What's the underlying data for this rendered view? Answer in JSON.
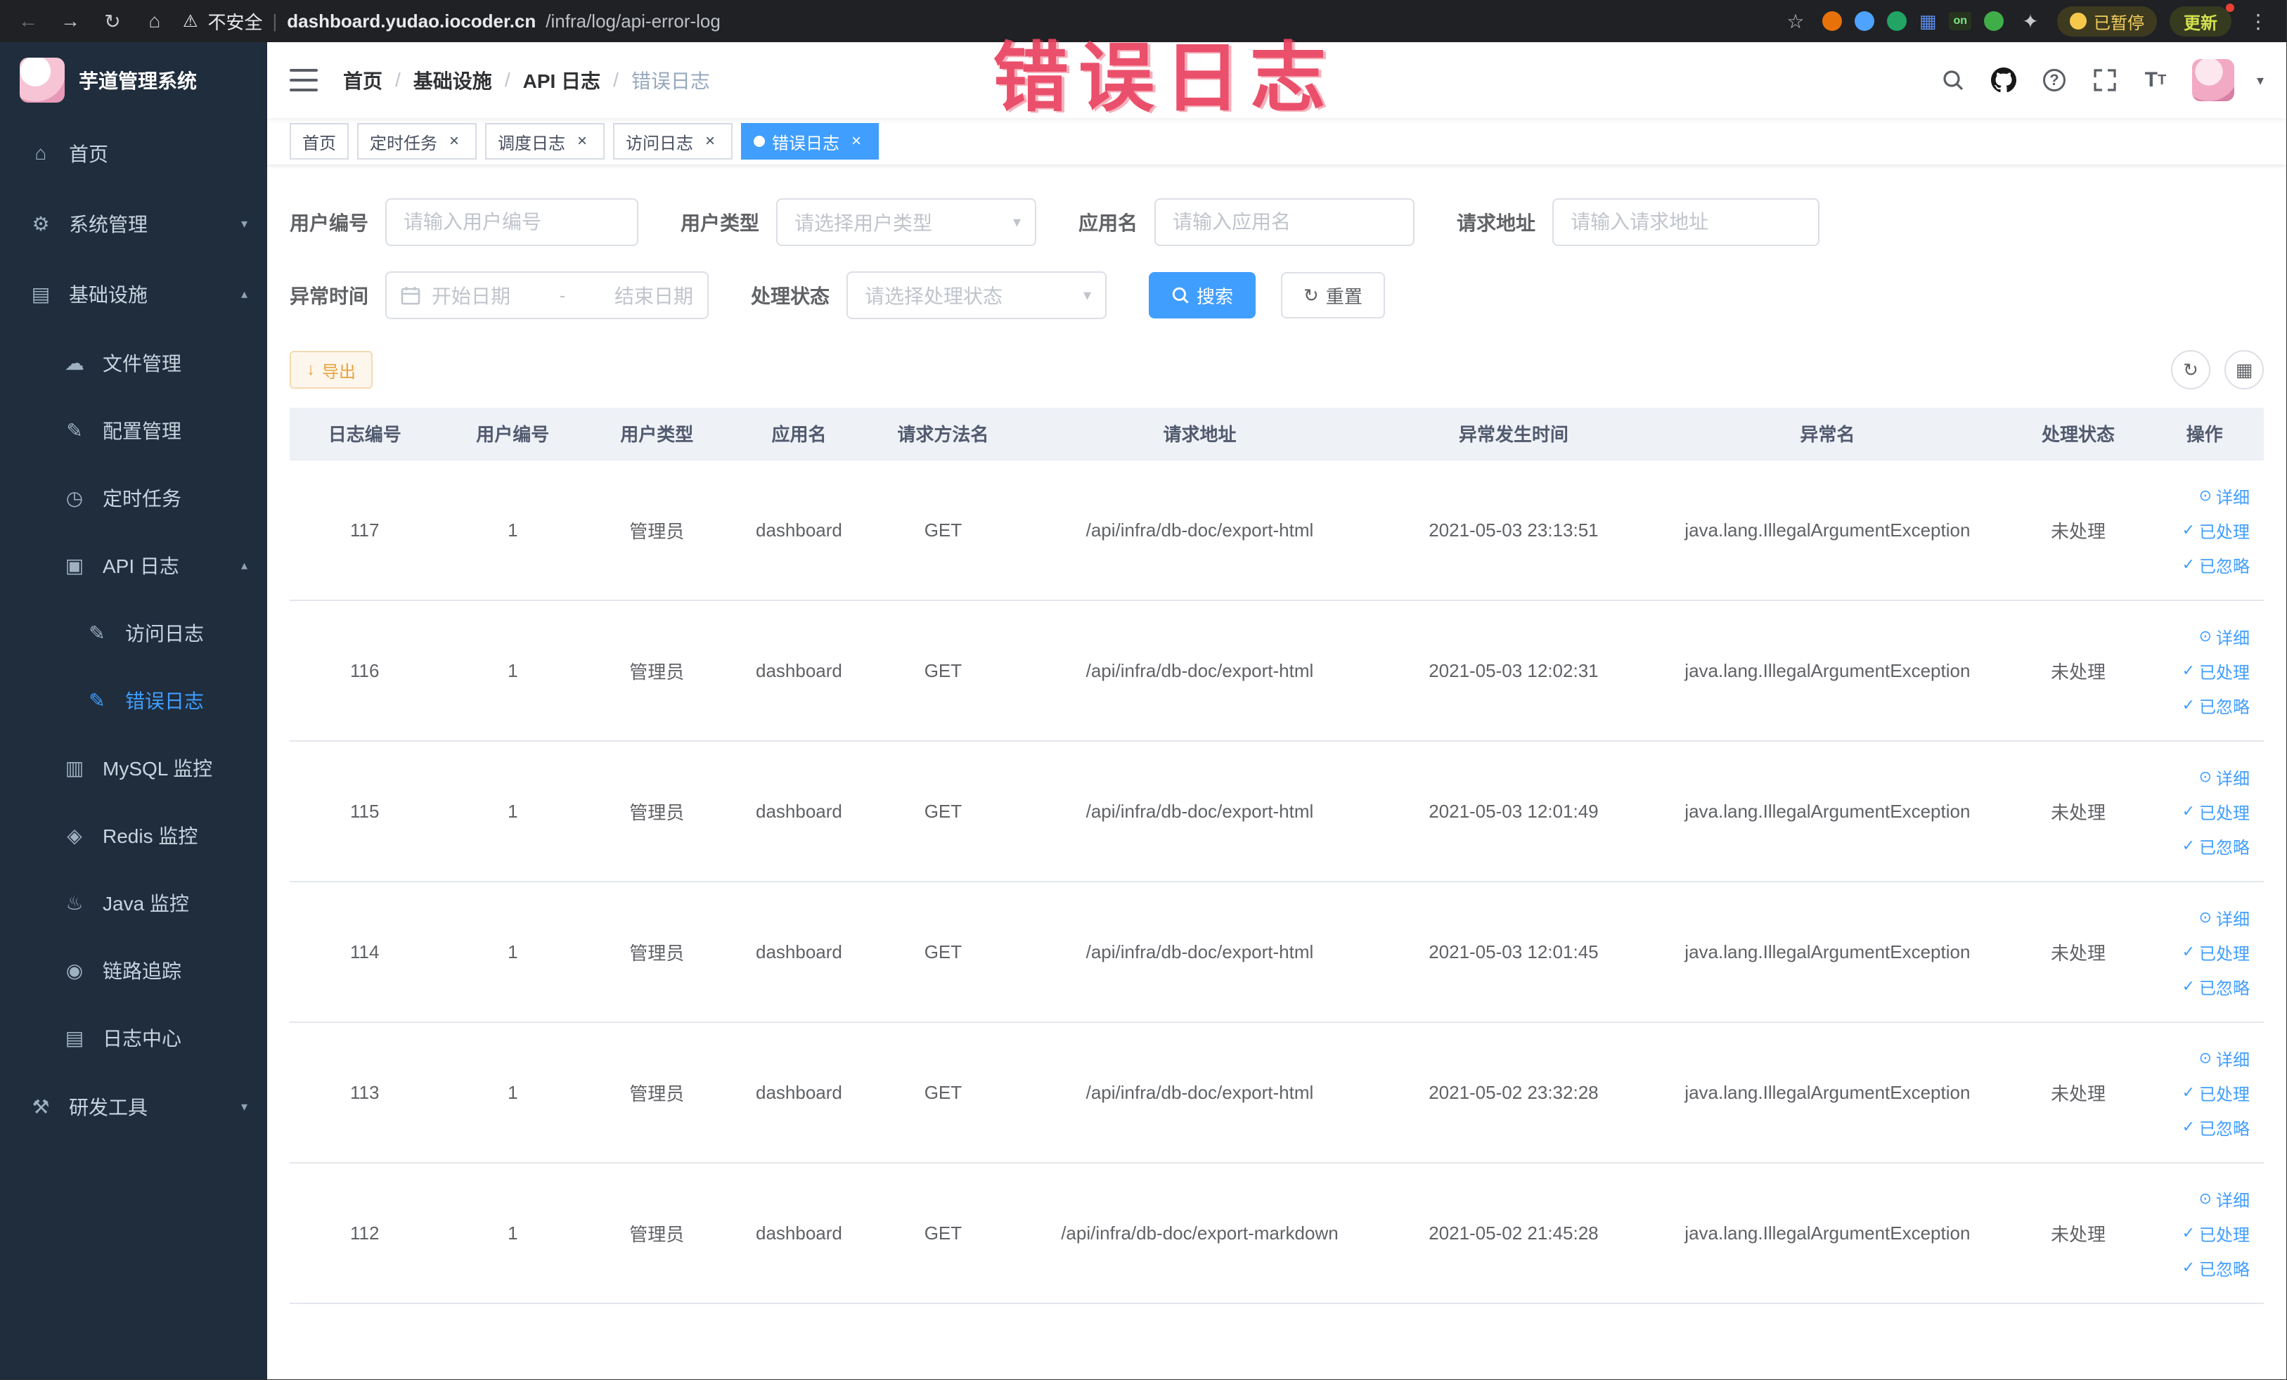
{
  "colors": {
    "primary": "#409eff",
    "warning": "#e6a23c",
    "stamp": "#e94360",
    "sidebar_bg": "#1f2d3d"
  },
  "browser": {
    "security_label": "不安全",
    "url_host": "dashboard.yudao.iocoder.cn",
    "url_path": "/infra/log/api-error-log",
    "on_badge": "on",
    "paused_badge": "已暂停",
    "update_button": "更新"
  },
  "overlay": {
    "stamp_text": "错误日志"
  },
  "sidebar": {
    "logo_title": "芋道管理系统",
    "items": [
      {
        "name": "home",
        "label": "首页",
        "icon": "home-icon",
        "level": 1
      },
      {
        "name": "system-management",
        "label": "系统管理",
        "icon": "gear-icon",
        "level": 1,
        "chevron": "down"
      },
      {
        "name": "infrastructure",
        "label": "基础设施",
        "icon": "grid-icon",
        "level": 1,
        "chevron": "up"
      },
      {
        "name": "file-management",
        "label": "文件管理",
        "icon": "cloud-icon",
        "level": 2
      },
      {
        "name": "config-management",
        "label": "配置管理",
        "icon": "edit-icon",
        "level": 2
      },
      {
        "name": "scheduled-tasks",
        "label": "定时任务",
        "icon": "clock-icon",
        "level": 2
      },
      {
        "name": "api-log",
        "label": "API 日志",
        "icon": "doc-icon",
        "level": 2,
        "chevron": "up"
      },
      {
        "name": "access-log",
        "label": "访问日志",
        "icon": "edit-doc-icon",
        "level": 3
      },
      {
        "name": "error-log",
        "label": "错误日志",
        "icon": "edit-doc-icon",
        "level": 3,
        "active": true
      },
      {
        "name": "mysql-monitor",
        "label": "MySQL 监控",
        "icon": "database-icon",
        "level": 2
      },
      {
        "name": "redis-monitor",
        "label": "Redis 监控",
        "icon": "layers-icon",
        "level": 2
      },
      {
        "name": "java-monitor",
        "label": "Java 监控",
        "icon": "java-icon",
        "level": 2
      },
      {
        "name": "link-trace",
        "label": "链路追踪",
        "icon": "eye-icon",
        "level": 2
      },
      {
        "name": "log-center",
        "label": "日志中心",
        "icon": "log-icon",
        "level": 2
      },
      {
        "name": "dev-tools",
        "label": "研发工具",
        "icon": "tools-icon",
        "level": 1,
        "chevron": "down"
      }
    ]
  },
  "header": {
    "breadcrumb": [
      "首页",
      "基础设施",
      "API 日志",
      "错误日志"
    ]
  },
  "tabs": [
    {
      "name": "home",
      "label": "首页",
      "closable": false,
      "active": false
    },
    {
      "name": "scheduled-tasks",
      "label": "定时任务",
      "closable": true,
      "active": false
    },
    {
      "name": "schedule-log",
      "label": "调度日志",
      "closable": true,
      "active": false
    },
    {
      "name": "access-log",
      "label": "访问日志",
      "closable": true,
      "active": false
    },
    {
      "name": "error-log",
      "label": "错误日志",
      "closable": true,
      "active": true
    }
  ],
  "filters": {
    "user_id": {
      "label": "用户编号",
      "placeholder": "请输入用户编号"
    },
    "user_type": {
      "label": "用户类型",
      "placeholder": "请选择用户类型"
    },
    "app_name": {
      "label": "应用名",
      "placeholder": "请输入应用名"
    },
    "request_url": {
      "label": "请求地址",
      "placeholder": "请输入请求地址"
    },
    "exception_time": {
      "label": "异常时间",
      "start_placeholder": "开始日期",
      "separator": "-",
      "end_placeholder": "结束日期"
    },
    "process_status": {
      "label": "处理状态",
      "placeholder": "请选择处理状态"
    },
    "search_button": "搜索",
    "reset_button": "重置"
  },
  "toolbar": {
    "export_button": "导出"
  },
  "table": {
    "columns": [
      "日志编号",
      "用户编号",
      "用户类型",
      "应用名",
      "请求方法名",
      "请求地址",
      "异常发生时间",
      "异常名",
      "处理状态",
      "操作"
    ],
    "action_labels": {
      "detail": "详细",
      "processed": "已处理",
      "ignored": "已忽略"
    },
    "rows": [
      {
        "id": "117",
        "user_id": "1",
        "user_type": "管理员",
        "app": "dashboard",
        "method": "GET",
        "url": "/api/infra/db-doc/export-html",
        "time": "2021-05-03 23:13:51",
        "exception": "java.lang.IllegalArgumentException",
        "status": "未处理"
      },
      {
        "id": "116",
        "user_id": "1",
        "user_type": "管理员",
        "app": "dashboard",
        "method": "GET",
        "url": "/api/infra/db-doc/export-html",
        "time": "2021-05-03 12:02:31",
        "exception": "java.lang.IllegalArgumentException",
        "status": "未处理"
      },
      {
        "id": "115",
        "user_id": "1",
        "user_type": "管理员",
        "app": "dashboard",
        "method": "GET",
        "url": "/api/infra/db-doc/export-html",
        "time": "2021-05-03 12:01:49",
        "exception": "java.lang.IllegalArgumentException",
        "status": "未处理"
      },
      {
        "id": "114",
        "user_id": "1",
        "user_type": "管理员",
        "app": "dashboard",
        "method": "GET",
        "url": "/api/infra/db-doc/export-html",
        "time": "2021-05-03 12:01:45",
        "exception": "java.lang.IllegalArgumentException",
        "status": "未处理"
      },
      {
        "id": "113",
        "user_id": "1",
        "user_type": "管理员",
        "app": "dashboard",
        "method": "GET",
        "url": "/api/infra/db-doc/export-html",
        "time": "2021-05-02 23:32:28",
        "exception": "java.lang.IllegalArgumentException",
        "status": "未处理"
      },
      {
        "id": "112",
        "user_id": "1",
        "user_type": "管理员",
        "app": "dashboard",
        "method": "GET",
        "url": "/api/infra/db-doc/export-markdown",
        "time": "2021-05-02 21:45:28",
        "exception": "java.lang.IllegalArgumentException",
        "status": "未处理"
      }
    ]
  }
}
